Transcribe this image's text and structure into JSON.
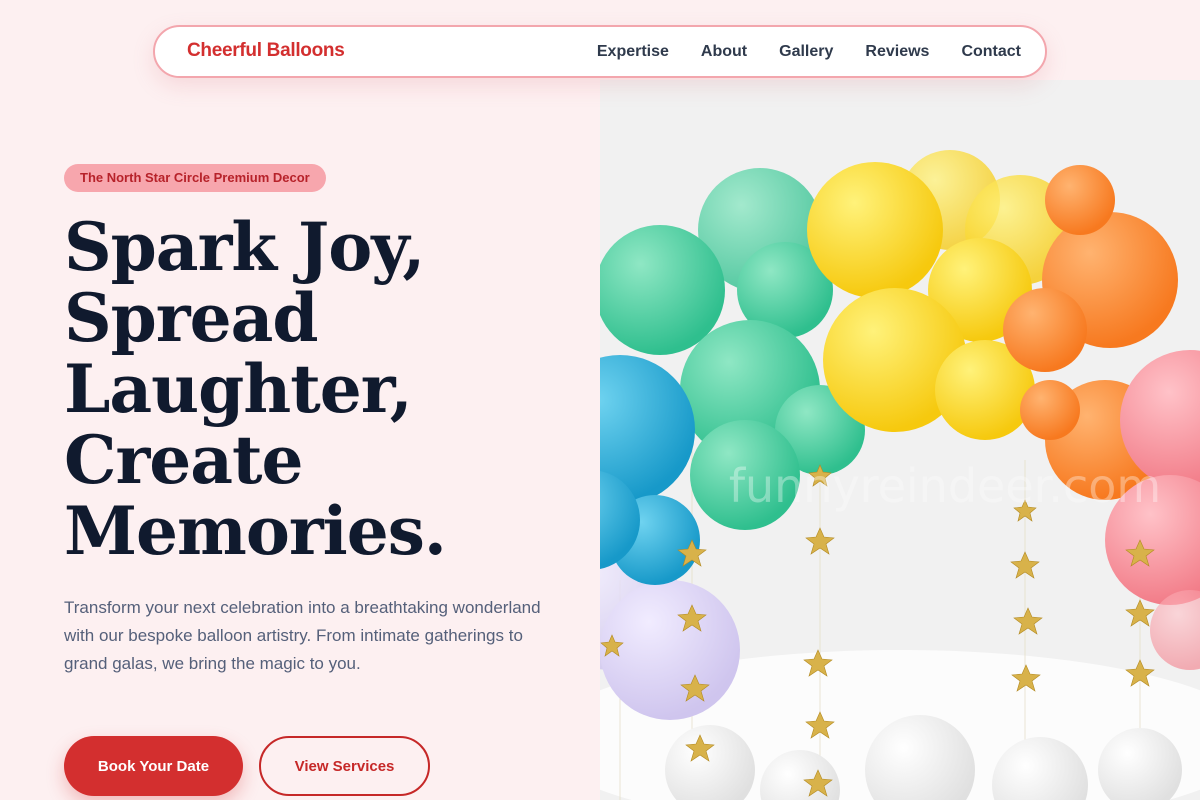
{
  "brand": {
    "name": "Cheerful Balloons"
  },
  "nav": {
    "links": [
      "Expertise",
      "About",
      "Gallery",
      "Reviews",
      "Contact"
    ]
  },
  "hero": {
    "badge": "The North Star Circle Premium Decor",
    "headline": [
      "Spark Joy,",
      "Spread",
      "Laughter,",
      "Create",
      "Memories."
    ],
    "lead": "Transform your next celebration into a breathtaking wonderland with our bespoke balloon artistry. From intimate gatherings to grand galas, we bring the magic to you.",
    "primary_cta": "Book Your Date",
    "secondary_cta": "View Services"
  },
  "image": {
    "watermark": "funnyreindeer.com"
  },
  "colors": {
    "accent": "#d32f2f",
    "background": "#fdf0f1",
    "badge": "#f7a6ad",
    "heading": "#101a2e"
  }
}
